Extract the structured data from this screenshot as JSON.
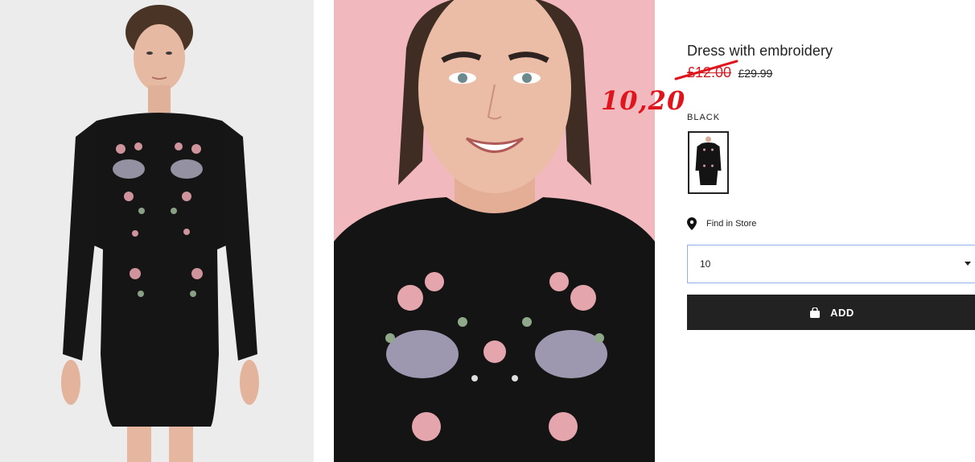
{
  "product": {
    "title": "Dress with embroidery",
    "sale_price": "£12.00",
    "original_price": "£29.99",
    "annotated_price": "10,20",
    "color_label": "BLACK",
    "find_in_store_label": "Find in Store",
    "size_value": "10",
    "add_label": "ADD"
  },
  "colors": {
    "sale_red": "#d01c24",
    "annotation_red": "#e0141c",
    "button_bg": "#222222",
    "select_border": "#8fb0e8",
    "pink_backdrop": "#f1b8bd"
  },
  "icons": {
    "store": "location-pin-icon",
    "add": "shopping-bag-icon",
    "select": "chevron-down-icon"
  }
}
